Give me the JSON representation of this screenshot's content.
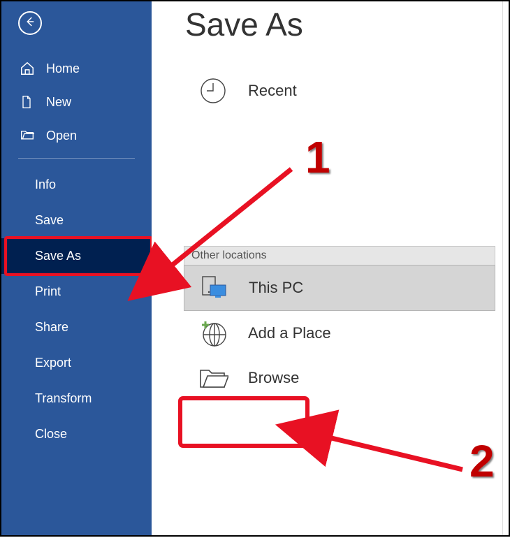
{
  "sidebar": {
    "primary": [
      {
        "label": "Home",
        "icon": "home-icon"
      },
      {
        "label": "New",
        "icon": "new-doc-icon"
      },
      {
        "label": "Open",
        "icon": "open-folder-icon"
      }
    ],
    "secondary": [
      {
        "label": "Info"
      },
      {
        "label": "Save"
      },
      {
        "label": "Save As",
        "active": true
      },
      {
        "label": "Print"
      },
      {
        "label": "Share"
      },
      {
        "label": "Export"
      },
      {
        "label": "Transform"
      },
      {
        "label": "Close"
      }
    ]
  },
  "page": {
    "title": "Save As"
  },
  "locations": {
    "recent": {
      "label": "Recent"
    },
    "section_header": "Other locations",
    "this_pc": {
      "label": "This PC"
    },
    "add_place": {
      "label": "Add a Place"
    },
    "browse": {
      "label": "Browse"
    }
  },
  "annotations": {
    "marker1": "1",
    "marker2": "2"
  }
}
